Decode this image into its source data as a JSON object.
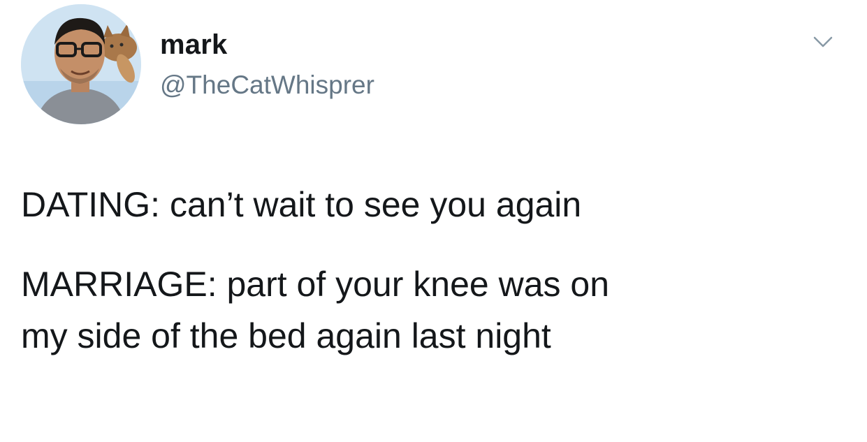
{
  "tweet": {
    "author": {
      "display_name": "mark",
      "handle": "@TheCatWhisprer",
      "avatar_icon": "profile-photo-man-with-glasses-and-cat"
    },
    "menu_icon": "chevron-down-icon",
    "body": {
      "line1": "DATING: can’t wait to see you again",
      "line2": "MARRIAGE: part of your knee was on",
      "line3": "my side of the bed again last night"
    }
  },
  "colors": {
    "background": "#ffffff",
    "text_primary": "#14171a",
    "text_secondary": "#657786",
    "chevron": "#8899a6"
  }
}
